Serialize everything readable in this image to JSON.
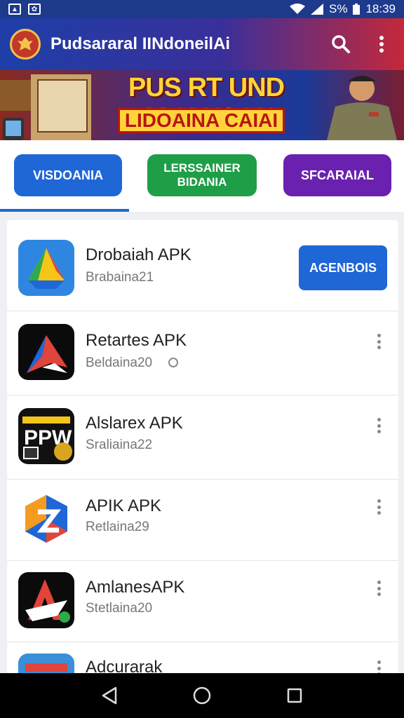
{
  "status_bar": {
    "battery": "S%",
    "time": "18:39"
  },
  "app_bar": {
    "title": "Pudsararal IINdoneilAi"
  },
  "banner": {
    "headline": "PUS RT UND ADIANSAN",
    "subheadline": "LIDOAINA CAIAI"
  },
  "categories": [
    {
      "label": "VISDOANIA"
    },
    {
      "label": "LERSSAINER BIDANIA"
    },
    {
      "label": "SFCARAIAL"
    }
  ],
  "apps": [
    {
      "name": "Drobaiah APK",
      "version": "Brabaina21",
      "action_label": "AGENBOIS"
    },
    {
      "name": "Retartes APK",
      "version": "Beldaina20"
    },
    {
      "name": "Alslarex APK",
      "version": "Sraliaina22",
      "icon_text": "PPW"
    },
    {
      "name": "APIK APK",
      "version": "Retlaina29"
    },
    {
      "name": "AmlanesAPK",
      "version": "Stetlaina20"
    },
    {
      "name": "Adcurarak",
      "version": ""
    }
  ],
  "colors": {
    "primary": "#1f66d6",
    "green": "#1f9e48",
    "purple": "#6a21b0",
    "banner_yellow": "#ffd43b"
  }
}
